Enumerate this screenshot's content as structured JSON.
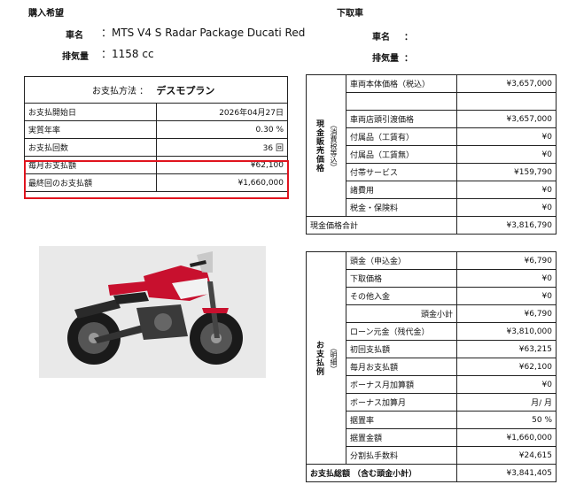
{
  "purchase": {
    "heading": "購入希望",
    "name_label": "車名",
    "name_value": "：MTS V4 S Radar Package Ducati Red",
    "cc_label": "排気量",
    "cc_value": "：1158 cc"
  },
  "tradein": {
    "heading": "下取車",
    "name_label": "車名",
    "name_value": "：",
    "cc_label": "排気量",
    "cc_value": "："
  },
  "plan": {
    "method_label": "お支払方法 ：",
    "method_value": "デスモプラン",
    "rows": [
      {
        "label": "お支払開始日",
        "value": "2026年04月27日"
      },
      {
        "label": "実質年率",
        "value": "0.30 %"
      },
      {
        "label": "お支払回数",
        "value": "36 回"
      },
      {
        "label": "毎月お支払額",
        "value": "¥62,100"
      },
      {
        "label": "最終回のお支払額",
        "value": "¥1,660,000"
      }
    ]
  },
  "cash": {
    "group_label": "現金販売価格",
    "group_sub": "（消費税等込）",
    "rows": [
      {
        "label": "車両本体価格（税込）",
        "value": "¥3,657,000"
      },
      {
        "label": "",
        "value": ""
      },
      {
        "label": "車両店頭引渡価格",
        "value": "¥3,657,000"
      },
      {
        "label": "付属品（工賃有）",
        "value": "¥0"
      },
      {
        "label": "付属品（工賃無）",
        "value": "¥0"
      },
      {
        "label": "付帯サービス",
        "value": "¥159,790"
      },
      {
        "label": "諸費用",
        "value": "¥0"
      },
      {
        "label": "税金・保険料",
        "value": "¥0"
      }
    ],
    "total_label": "現金価格合計",
    "total_value": "¥3,816,790"
  },
  "payment": {
    "group_label": "お支払例",
    "group_sub": "（明細）",
    "rows": [
      {
        "label": "頭金（申込金）",
        "value": "¥6,790"
      },
      {
        "label": "下取価格",
        "value": "¥0"
      },
      {
        "label": "その他入金",
        "value": "¥0"
      },
      {
        "label": "頭金小計",
        "value": "¥6,790"
      },
      {
        "label": "ローン元金（残代金）",
        "value": "¥3,810,000"
      },
      {
        "label": "初回支払額",
        "value": "¥63,215"
      },
      {
        "label": "毎月お支払額",
        "value": "¥62,100"
      },
      {
        "label": "ボーナス月加算額",
        "value": "¥0"
      },
      {
        "label": "ボーナス加算月",
        "value": "月/ 月"
      },
      {
        "label": "据置率",
        "value": "50 %"
      },
      {
        "label": "据置金額",
        "value": "¥1,660,000"
      },
      {
        "label": "分割払手数料",
        "value": "¥24,615"
      }
    ],
    "total_label": "お支払総額 （含む頭金小計）",
    "total_value": "¥3,841,405"
  },
  "colors": {
    "highlight": "#e0141e",
    "bike_red": "#c8102e",
    "photo_bg": "#e9e9e9"
  }
}
